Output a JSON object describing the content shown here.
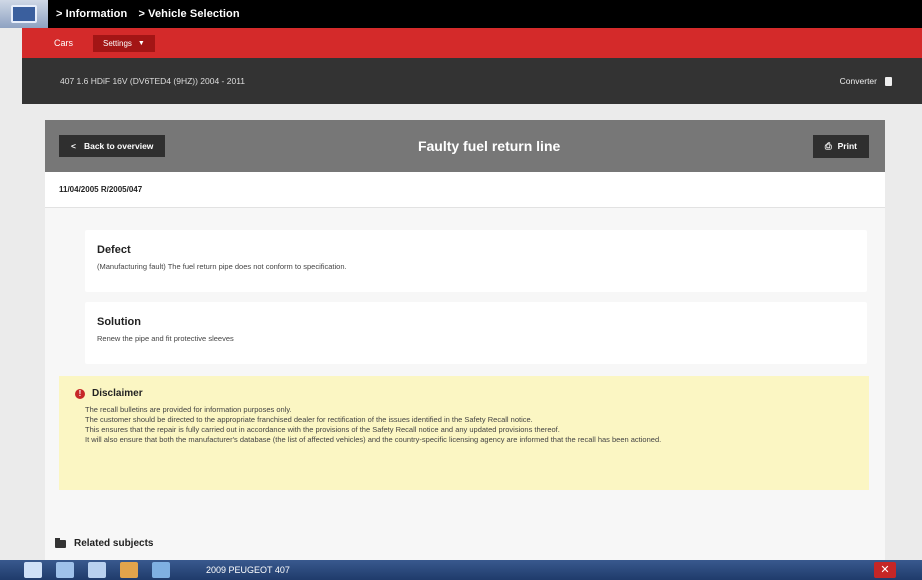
{
  "topbar": {
    "breadcrumb": [
      "> Information",
      "> Vehicle Selection"
    ]
  },
  "menu": {
    "cars_label": "Cars",
    "settings_label": "Settings"
  },
  "vehicle": {
    "title": "407 1.6 HDiF 16V (DV6TED4 (9HZ)) 2004 - 2011",
    "converter_label": "Converter"
  },
  "panel": {
    "back_label": "Back to overview",
    "title": "Faulty fuel return line",
    "print_label": "Print",
    "date_ref": "11/04/2005 R/2005/047"
  },
  "defect": {
    "heading": "Defect",
    "text": "(Manufacturing fault) The fuel return pipe does not conform to specification."
  },
  "solution": {
    "heading": "Solution",
    "text": "Renew the pipe and fit protective sleeves"
  },
  "disclaimer": {
    "heading": "Disclaimer",
    "lines": [
      "The recall bulletins are provided for information purposes only.",
      "The customer should be directed to the appropriate franchised dealer for rectification of the issues identified in the Safety Recall notice.",
      "This ensures that the repair is fully carried out in accordance with the provisions of the Safety Recall notice and any updated provisions thereof.",
      "It will also ensure that both the manufacturer's database (the list of affected vehicles) and the country-specific licensing agency are informed that the recall has been actioned."
    ]
  },
  "related": {
    "label": "Related subjects"
  },
  "taskbar": {
    "label": "2009 PEUGEOT 407"
  },
  "colors": {
    "accent_red": "#d42a2a",
    "dark_bar": "#333333",
    "disclaimer_bg": "#fbf6c3"
  }
}
